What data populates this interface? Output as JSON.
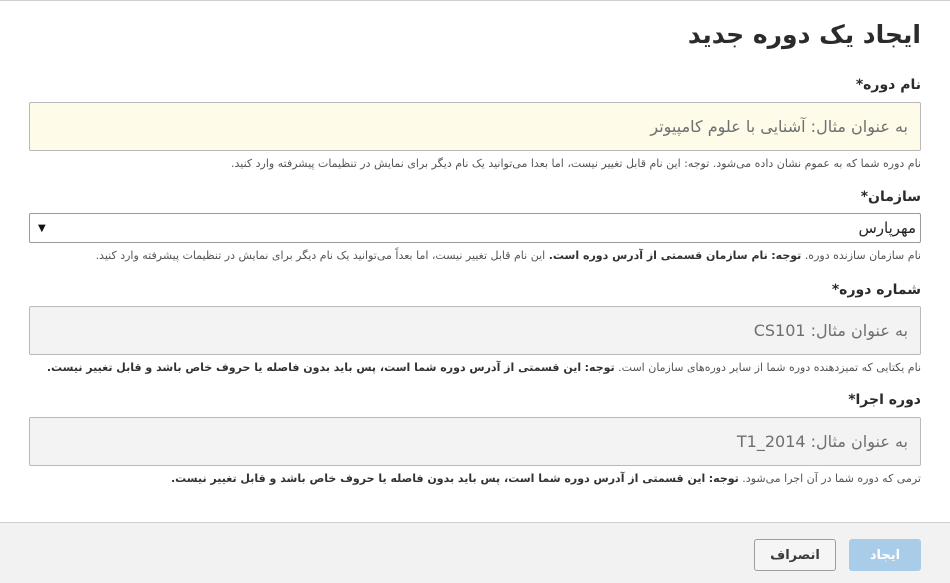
{
  "header": {
    "title": "ایجاد یک دوره جدید"
  },
  "form": {
    "course_name": {
      "label": "نام دوره*",
      "placeholder": "به عنوان مثال: آشنایی با علوم کامپیوتر",
      "value": "",
      "help": "نام دوره شما که به عموم نشان داده می‌شود. توجه: این نام قابل تغییر نیست، اما بعدا می‌توانید یک نام دیگر برای نمایش در تنظیمات پیشرفته وارد کنید."
    },
    "organization": {
      "label": "سازمان*",
      "selected": "مهرپارس",
      "help_prefix": "نام سازمان سازنده دوره.",
      "help_note_label": "توجه:",
      "help_bold": "نام سازمان قسمتی از آدرس دوره است.",
      "help_suffix": "این نام قابل تغییر نیست، اما بعداً می‌توانید یک نام دیگر برای نمایش در تنظیمات پیشرفته وارد کنید."
    },
    "course_number": {
      "label": "شماره دوره*",
      "placeholder": "به عنوان مثال: CS101",
      "value": "",
      "help_prefix": "نام یکتایی که تمیزدهنده دوره شما از سایر دوره‌های سازمان است.",
      "help_note_label": "توجه:",
      "help_bold": "این قسمتی از آدرس دوره شما است، پس باید بدون فاصله یا حروف خاص باشد و قابل تغییر نیست."
    },
    "course_run": {
      "label": "دوره اجرا*",
      "placeholder": "به عنوان مثال: T1_2014",
      "value": "",
      "help_prefix": "ترمی که دوره شما در آن اجرا می‌شود.",
      "help_note_label": "توجه:",
      "help_bold": "این قسمتی از آدرس دوره شما است، پس باید بدون فاصله یا حروف خاص باشد و قابل تغییر نیست."
    }
  },
  "actions": {
    "create_label": "ایجاد",
    "cancel_label": "انصراف"
  },
  "colors": {
    "create_button_bg": "#a9cce8",
    "name_input_bg": "#fefbe9",
    "disabled_input_bg": "#f3f3f3",
    "footer_bg": "#f2f2f2"
  }
}
